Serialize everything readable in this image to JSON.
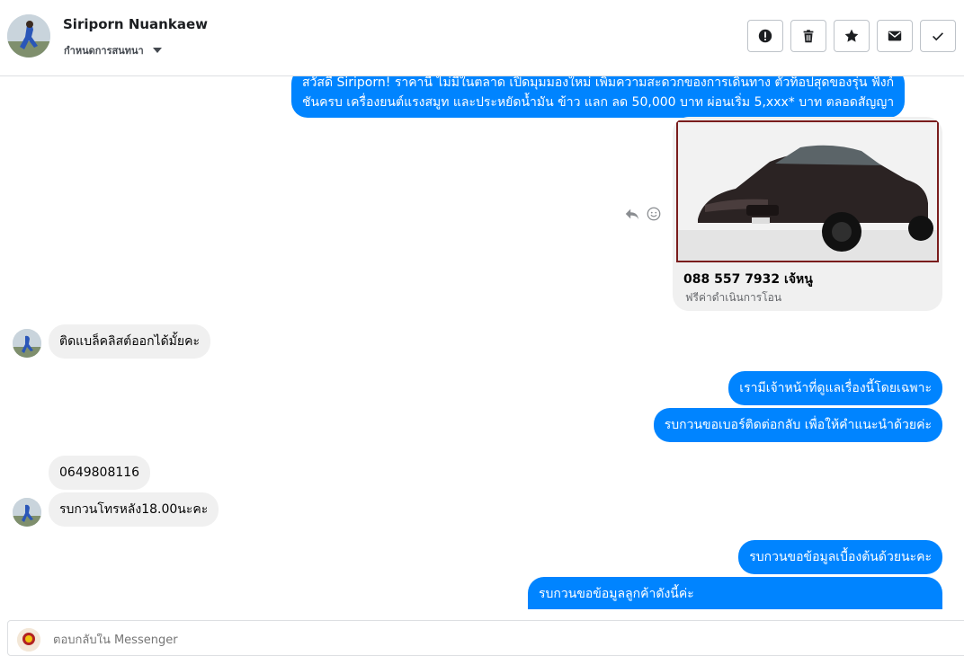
{
  "header": {
    "name": "Siriporn Nuankaew",
    "subtitle": "กำหนดการสนทนา",
    "tools": [
      {
        "icon": "alert-icon",
        "label": ""
      },
      {
        "icon": "trash-icon",
        "label": ""
      },
      {
        "icon": "star-icon",
        "label": ""
      },
      {
        "icon": "envelope-icon",
        "label": ""
      },
      {
        "icon": "check-icon",
        "label": ""
      }
    ]
  },
  "messages": {
    "out_intro_line1": "สวัสดี Siriporn! ราคานี้ ไม่มีในตลาด เปิดมุมมองใหม่ เพิ่มความสะดวกของการเดินทาง ตัวท็อปสุดของรุ่น ฟังก์",
    "out_intro_line2": "ชันครบ เครื่องยนต์แรงสมูท และประหยัดน้ำมัน ข้าว แลก ลด 50,000 บาท ผ่อนเริ่ม 5,xxx* บาท ตลอดสัญญา",
    "card_title": "088 557 7932 เจ้หนู",
    "card_subtitle": "ฟรีค่าดำเนินการโอน",
    "in_1": "ติดแบล็คลิสต์ออกได้มั้ยคะ",
    "out_2": "เรามีเจ้าหน้าที่ดูแลเรื่องนี้โดยเฉพาะ",
    "out_3": "รบกวนขอเบอร์ติดต่อกลับ เพื่อให้คำแนะนำด้วยค่ะ",
    "in_2": "0649808116",
    "in_3": "รบกวนโทรหลัง18.00นะคะ",
    "out_4": "รบกวนขอข้อมูลเบื้องต้นด้วยนะคะ",
    "out_5": "รบกวนขอข้อมูลลูกค้าดังนี้ค่ะ"
  },
  "composer": {
    "placeholder": "ตอบกลับใน Messenger"
  },
  "colors": {
    "accent": "#0084ff",
    "incoming_bubble": "#f0f0f0"
  }
}
